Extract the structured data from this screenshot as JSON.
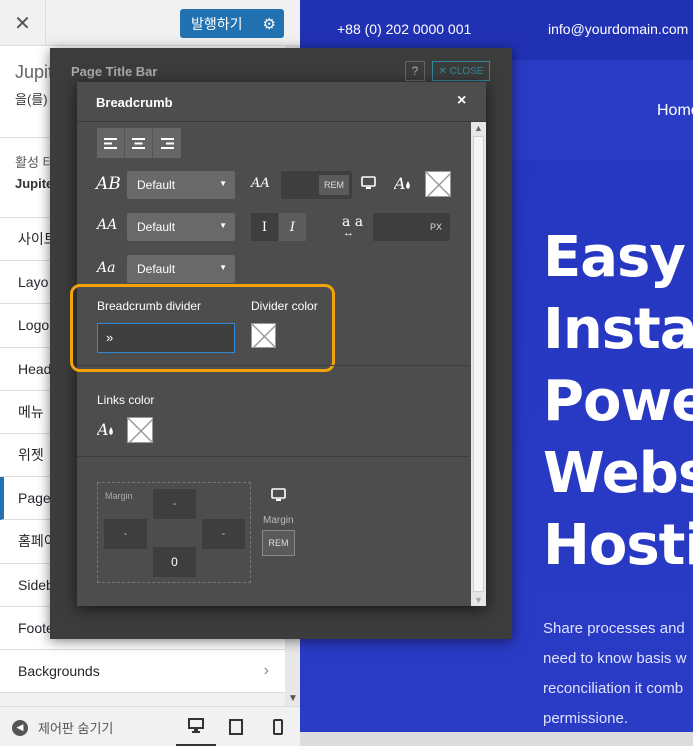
{
  "preview": {
    "phone": "+88 (0) 202 0000 001",
    "email": "info@yourdomain.com",
    "nav_home": "Home",
    "hero_lines": [
      "Easy",
      "Instal",
      "Powe",
      "Webs",
      "Hostir"
    ],
    "paragraph_lines": [
      "Share processes and",
      "need to know basis w",
      "reconciliation it comb",
      "permissione."
    ]
  },
  "customizer": {
    "close_icon": "close-icon",
    "publish_label": "발행하기",
    "title_main": "Jupit",
    "title_sub": "을(를)",
    "active_label": "활성 터",
    "active_value": "Jupite",
    "items": [
      {
        "label": "사이트"
      },
      {
        "label": "Layo"
      },
      {
        "label": "Logo"
      },
      {
        "label": "Head"
      },
      {
        "label": "메뉴"
      },
      {
        "label": "위젯"
      },
      {
        "label": "Page"
      },
      {
        "label": "홈페이"
      },
      {
        "label": "Sideb"
      },
      {
        "label": "Foote"
      },
      {
        "label": "Backgrounds"
      }
    ],
    "hide_controls": "제어판 숨기기"
  },
  "outer_dialog": {
    "title": "Page Title Bar",
    "help": "?",
    "close_label": "✕ CLOSE"
  },
  "breadcrumb_dialog": {
    "title": "Breadcrumb",
    "close": "×",
    "font_family": "Default",
    "font_size_unit": "REM",
    "font_weight": "Default",
    "letter_spacing_unit": "PX",
    "font_style": "Default",
    "bold_btn": "I",
    "italic_btn": "I",
    "letter_spacing_icon": "a a",
    "divider_label": "Breadcrumb divider",
    "divider_value": "»",
    "divider_color_label": "Divider color",
    "links_color_label": "Links color",
    "margin_label": "Margin",
    "margin_top": "-",
    "margin_left": "-",
    "margin_right": "-",
    "margin_bottom": "0",
    "margin_side_label": "Margin",
    "margin_unit": "REM"
  }
}
